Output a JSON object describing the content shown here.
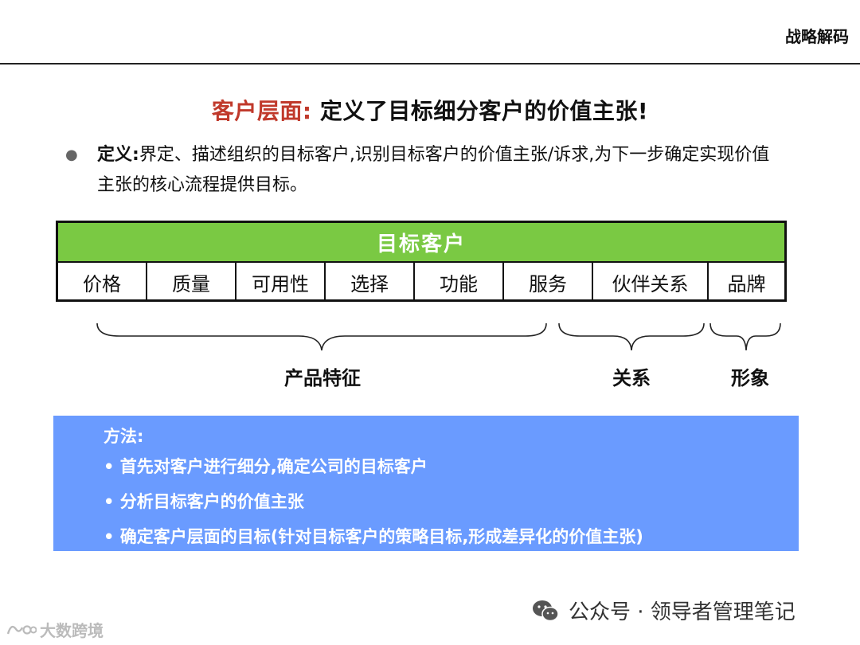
{
  "header": {
    "label": "战略解码"
  },
  "title": {
    "accent": "客户层面:",
    "rest": " 定义了目标细分客户的价值主张!"
  },
  "definition": {
    "label": "定义:",
    "text": "界定、描述组织的目标客户,识别目标客户的价值主张/诉求,为下一步确定实现价值主张的核心流程提供目标。"
  },
  "customer_table": {
    "header": "目标客户",
    "header_color": "#7ac943",
    "cells": [
      "价格",
      "质量",
      "可用性",
      "选择",
      "功能",
      "服务",
      "伙伴关系",
      "品牌"
    ]
  },
  "groups": {
    "product": "产品特征",
    "relation": "关系",
    "image": "形象"
  },
  "method": {
    "title": "方法:",
    "items": [
      "• 首先对客户进行细分,确定公司的目标客户",
      "• 分析目标客户的价值主张",
      "• 确定客户层面的目标(针对目标客户的策略目标,形成差异化的价值主张)"
    ],
    "background_color": "#6a9bff"
  },
  "footer": {
    "brand": "公众号 · 领导者管理笔记",
    "watermark": "大数跨境"
  },
  "icons": {
    "wechat": "wechat-icon",
    "watermark_logo": "watermark-logo-icon"
  }
}
